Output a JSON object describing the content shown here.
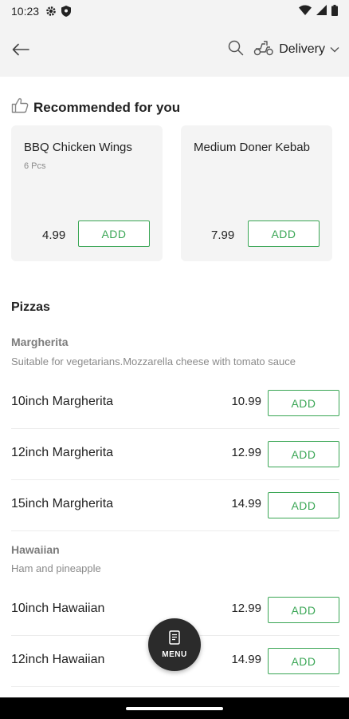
{
  "status_bar": {
    "time": "10:23"
  },
  "header": {
    "delivery_label": "Delivery"
  },
  "recommended": {
    "title": "Recommended for you",
    "items": [
      {
        "name": "BBQ Chicken Wings",
        "sub": "6 Pcs",
        "price": "4.99",
        "add_label": "ADD"
      },
      {
        "name": "Medium Doner Kebab",
        "price": "7.99",
        "add_label": "ADD"
      }
    ]
  },
  "menu": {
    "category": "Pizzas",
    "groups": [
      {
        "title": "Margherita",
        "desc": "Suitable for vegetarians.Mozzarella cheese with tomato sauce",
        "items": [
          {
            "name": "10inch Margherita",
            "price": "10.99",
            "add_label": "ADD"
          },
          {
            "name": "12inch Margherita",
            "price": "12.99",
            "add_label": "ADD"
          },
          {
            "name": "15inch Margherita",
            "price": "14.99",
            "add_label": "ADD"
          }
        ]
      },
      {
        "title": "Hawaiian",
        "desc": "Ham and pineapple",
        "items": [
          {
            "name": "10inch Hawaiian",
            "price": "12.99",
            "add_label": "ADD"
          },
          {
            "name": "12inch Hawaiian",
            "price": "14.99",
            "add_label": "ADD"
          }
        ]
      }
    ]
  },
  "fab": {
    "label": "MENU"
  },
  "colors": {
    "accent": "#3aa655",
    "background": "#f3f3f3",
    "fab": "#2b2b2b"
  },
  "icons": [
    "settings-icon",
    "shield-icon",
    "wifi-icon",
    "signal-icon",
    "battery-icon",
    "back-arrow-icon",
    "search-icon",
    "delivery-scooter-icon",
    "chevron-down-icon",
    "thumbs-up-icon",
    "menu-book-icon"
  ]
}
